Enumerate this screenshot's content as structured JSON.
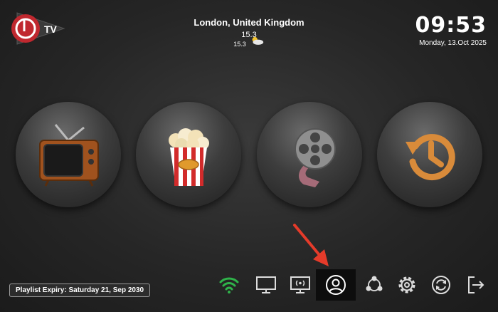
{
  "app": {
    "logo_text": "TV"
  },
  "weather": {
    "location": "London, United Kingdom",
    "temperature": "15.3",
    "temperature_secondary": "15.3",
    "icon": "partly-cloudy-icon"
  },
  "clock": {
    "time": "09:53",
    "date": "Monday, 13.Oct 2025"
  },
  "tiles": [
    {
      "icon": "tv-icon"
    },
    {
      "icon": "popcorn-icon"
    },
    {
      "icon": "film-reel-icon"
    },
    {
      "icon": "history-icon"
    }
  ],
  "footer": {
    "expiry": "Playlist Expiry: Saturday 21, Sep 2030"
  },
  "toolbar": {
    "items": [
      "wifi-icon",
      "monitor-icon",
      "cast-icon",
      "user-icon",
      "network-icon",
      "settings-icon",
      "refresh-icon",
      "logout-icon"
    ],
    "active": "user-icon"
  },
  "colors": {
    "accent_red": "#c0282f",
    "wifi_green": "#2fb34a",
    "clock_orange": "#d98b3a",
    "annotation_arrow": "#e53b2a"
  }
}
